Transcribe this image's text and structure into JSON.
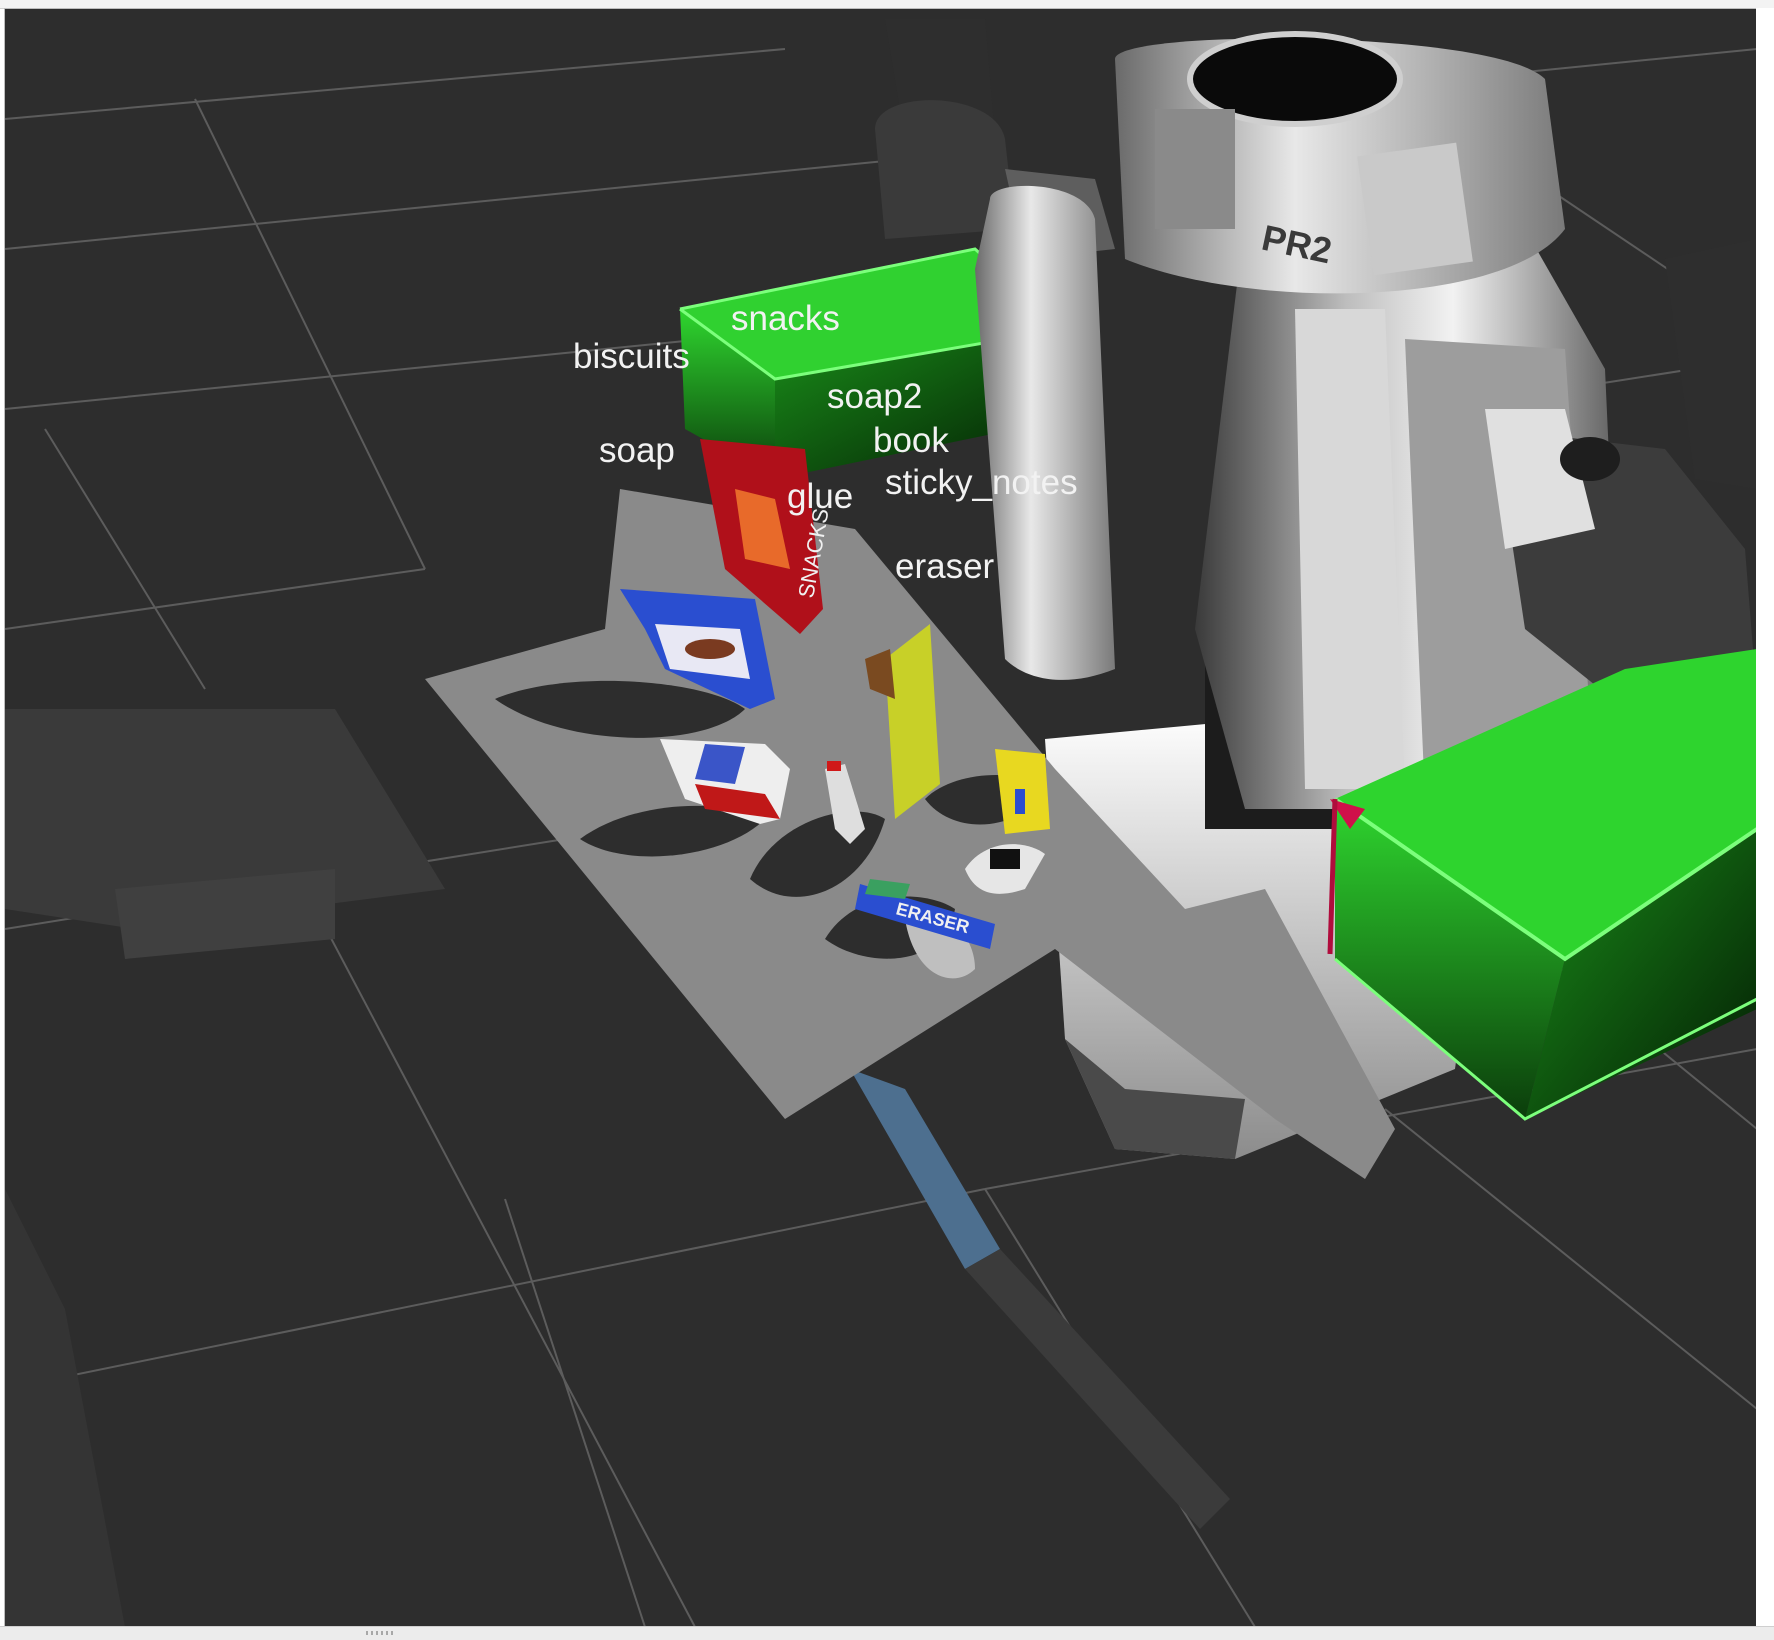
{
  "window": {
    "type": "rviz-3d-viewport"
  },
  "scene": {
    "robot_logo": "PR2",
    "colors": {
      "background": "#2d2d2d",
      "grid": "#5a5a5a",
      "table": "#8a8a8a",
      "bin": "#22c422",
      "robot_dark": "#3c3c3c",
      "robot_light": "#e6e6e6",
      "label": "#f2f2f2"
    }
  },
  "object_labels": [
    {
      "id": "snacks",
      "text": "snacks"
    },
    {
      "id": "biscuits",
      "text": "biscuits"
    },
    {
      "id": "soap2",
      "text": "soap2"
    },
    {
      "id": "book",
      "text": "book"
    },
    {
      "id": "soap",
      "text": "soap"
    },
    {
      "id": "glue",
      "text": "glue"
    },
    {
      "id": "sticky_notes",
      "text": "sticky_notes"
    },
    {
      "id": "eraser",
      "text": "eraser"
    }
  ],
  "printed_text": {
    "eraser_pack": "ERASER",
    "snacks_pack": "SNACKS"
  }
}
